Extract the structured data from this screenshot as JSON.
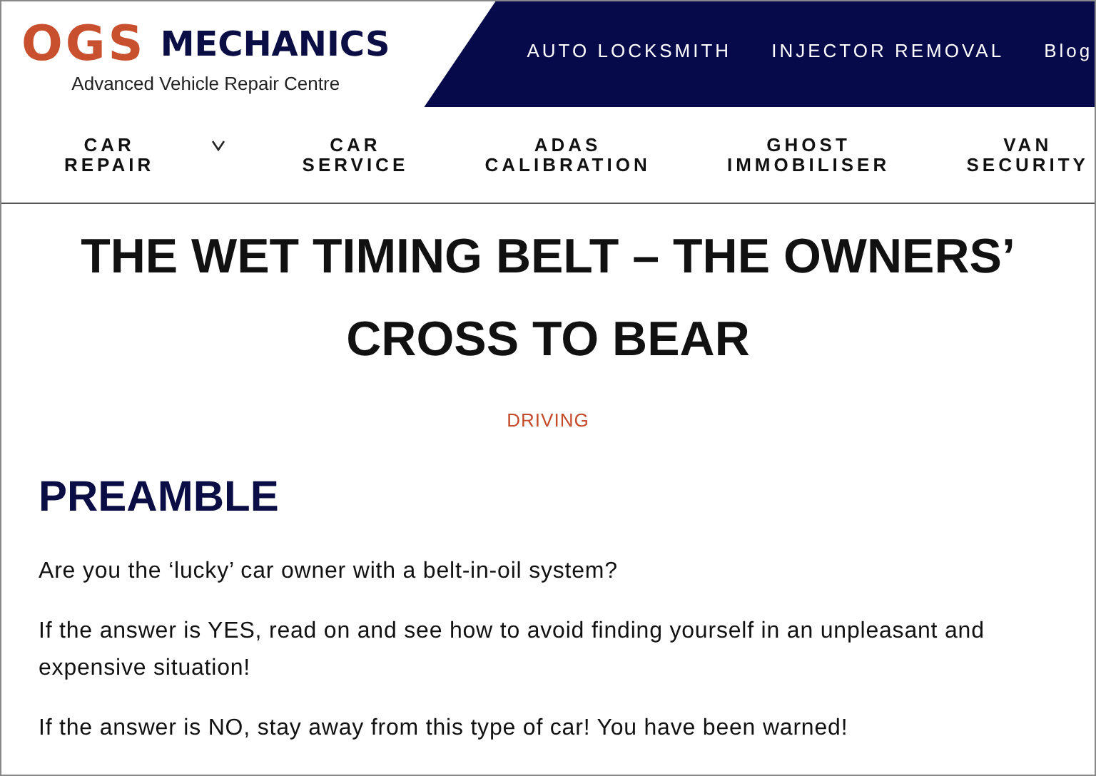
{
  "logo": {
    "mark": "OGS",
    "name": "MECHANICS",
    "tagline": "Advanced Vehicle Repair Centre"
  },
  "top_nav": [
    "AUTO LOCKSMITH",
    "INJECTOR REMOVAL",
    "Blog"
  ],
  "main_nav": [
    {
      "label": "CAR REPAIR",
      "has_dropdown": true
    },
    {
      "label": "CAR SERVICE",
      "has_dropdown": false
    },
    {
      "label": "ADAS CALIBRATION",
      "has_dropdown": false
    },
    {
      "label": "GHOST IMMOBILISER",
      "has_dropdown": false
    },
    {
      "label": "VAN SECURITY",
      "has_dropdown": false
    }
  ],
  "article": {
    "title": "THE WET TIMING BELT – THE OWNERS’ CROSS TO BEAR",
    "category": "DRIVING",
    "heading": "PREAMBLE",
    "paragraphs": [
      "Are you the ‘lucky’ car owner with a belt-in-oil system?",
      "If the answer is YES, read on and see how to avoid finding yourself in an unpleasant and expensive situation!",
      "If the answer is NO, stay away from this type of car! You have been warned!"
    ]
  }
}
